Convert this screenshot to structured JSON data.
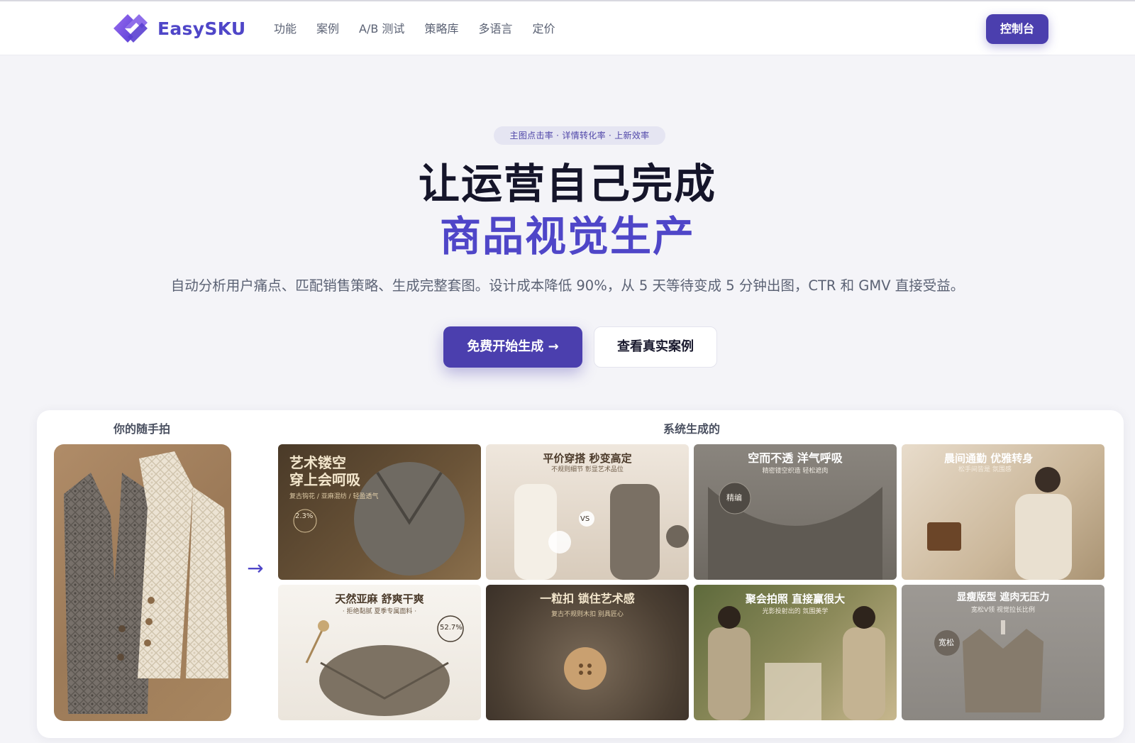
{
  "brand": {
    "name": "EasySKU",
    "logo_icon": "diamond-logo-icon"
  },
  "nav": {
    "links": [
      "功能",
      "案例",
      "A/B 测试",
      "策略库",
      "多语言",
      "定价"
    ],
    "console_button": "控制台"
  },
  "hero": {
    "badge": "主图点击率 · 详情转化率 · 上新效率",
    "title_line1": "让运营自己完成",
    "title_line2": "商品视觉生产",
    "subtitle": "自动分析用户痛点、匹配销售策略、生成完整套图。设计成本降低 90%，从 5 天等待变成 5 分钟出图，CTR 和 GMV 直接受益。",
    "cta_primary": "免费开始生成 →",
    "cta_secondary": "查看真实案例"
  },
  "showcase": {
    "input_label": "你的随手拍",
    "output_label": "系统生成的",
    "arrow": "→",
    "tiles": [
      {
        "title": "艺术镂空\n穿上会呵吸",
        "sub": "复古钩花 / 亚麻混纺 / 轻盈透气",
        "badge": "2.3%"
      },
      {
        "title": "平价穿搭 秒变高定",
        "sub": "不规则细节 彰显艺术品位",
        "badge": "VS"
      },
      {
        "title": "空而不透 洋气呼吸",
        "sub": "精密镂空织造 轻松遮肉",
        "badge": "精编"
      },
      {
        "title": "晨间通勤 优雅转身",
        "sub": "松手间皆是 氛围感",
        "badge": ""
      },
      {
        "title": "天然亚麻 舒爽干爽",
        "sub": "· 拒绝黏腻 夏季专属面料 ·",
        "badge": "52.7%"
      },
      {
        "title": "一粒扣 锁住艺术感",
        "sub": "复古不规则木扣 别具匠心",
        "badge": ""
      },
      {
        "title": "聚会拍照 直接赢很大",
        "sub": "光影投射出的 氛围美学",
        "badge": ""
      },
      {
        "title": "显瘦版型 遮肉无压力",
        "sub": "宽松V领 视觉拉长比例",
        "badge": "宽松"
      }
    ]
  },
  "colors": {
    "accent": "#4f46c8",
    "accent_dark": "#4b3fae",
    "page_bg": "#f4f4f8",
    "text_muted": "#5b6274"
  }
}
